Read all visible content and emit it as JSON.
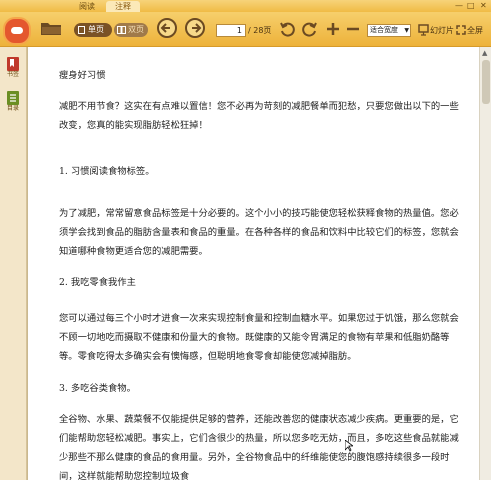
{
  "tabs": [
    {
      "label": "阅读",
      "active": false
    },
    {
      "label": "注释",
      "active": true
    }
  ],
  "window_controls": {
    "minimize": "—",
    "maximize": "□",
    "close": "✕"
  },
  "toolbar": {
    "single_page_label": "单页",
    "double_page_label": "双页",
    "current_page": "1",
    "page_count": "/ 28页",
    "fit_option": "适合宽度",
    "slideshow_label": "幻灯片",
    "fullscreen_label": "全屏"
  },
  "sidebar": {
    "items": [
      {
        "label": "书签",
        "icon": "bookmark-icon"
      },
      {
        "label": "目录",
        "icon": "toc-icon"
      }
    ]
  },
  "document": {
    "title": "瘦身好习惯",
    "intro": "减肥不用节食？这实在有点难以置信！您不必再为苛刻的减肥餐单而犯愁，只要您做出以下的一些改变，您真的能实现脂肪轻松狂掉！",
    "s1_title": "1. 习惯阅读食物标签。",
    "s1_body": "为了减肥，常常留意食品标签是十分必要的。这个小小的技巧能使您轻松获释食物的热量值。您必须学会找到食品的脂肪含量表和食品的重量。在各种各样的食品和饮料中比较它们的标签，您就会知道哪种食物更适合您的减肥需要。",
    "s2_title": "2. 我吃零食我作主",
    "s2_body": "您可以通过每三个小时才进食一次来实现控制食量和控制血糖水平。如果您过于饥饿，那么您就会不顾一切地吃而摄取不健康和份量大的食物。既健康的又能令胃满足的食物有苹果和低脂奶酪等等。零食吃得太多确实会有懊悔感，但聪明地食零食却能使您减掉脂肪。",
    "s3_title": "3. 多吃谷类食物。",
    "s3_body": "全谷物、水果、蔬菜餐不仅能提供足够的营养，还能改善您的健康状态减少疾病。更重要的是，它们能帮助您轻松减肥。事实上，它们含很少的热量，所以您多吃无妨，而且，多吃这些食品就能减少那些不那么健康的食品的食用量。另外，全谷物食品中的纤维能使您的腹饱感持续很多一段时间，这样就能帮助您控制垃圾食"
  },
  "colors": {
    "toolbar_top": "#f6cf6c",
    "toolbar_bottom": "#edb23a",
    "page_bg": "#ffffff",
    "frame_bg": "#f3e6c9"
  }
}
